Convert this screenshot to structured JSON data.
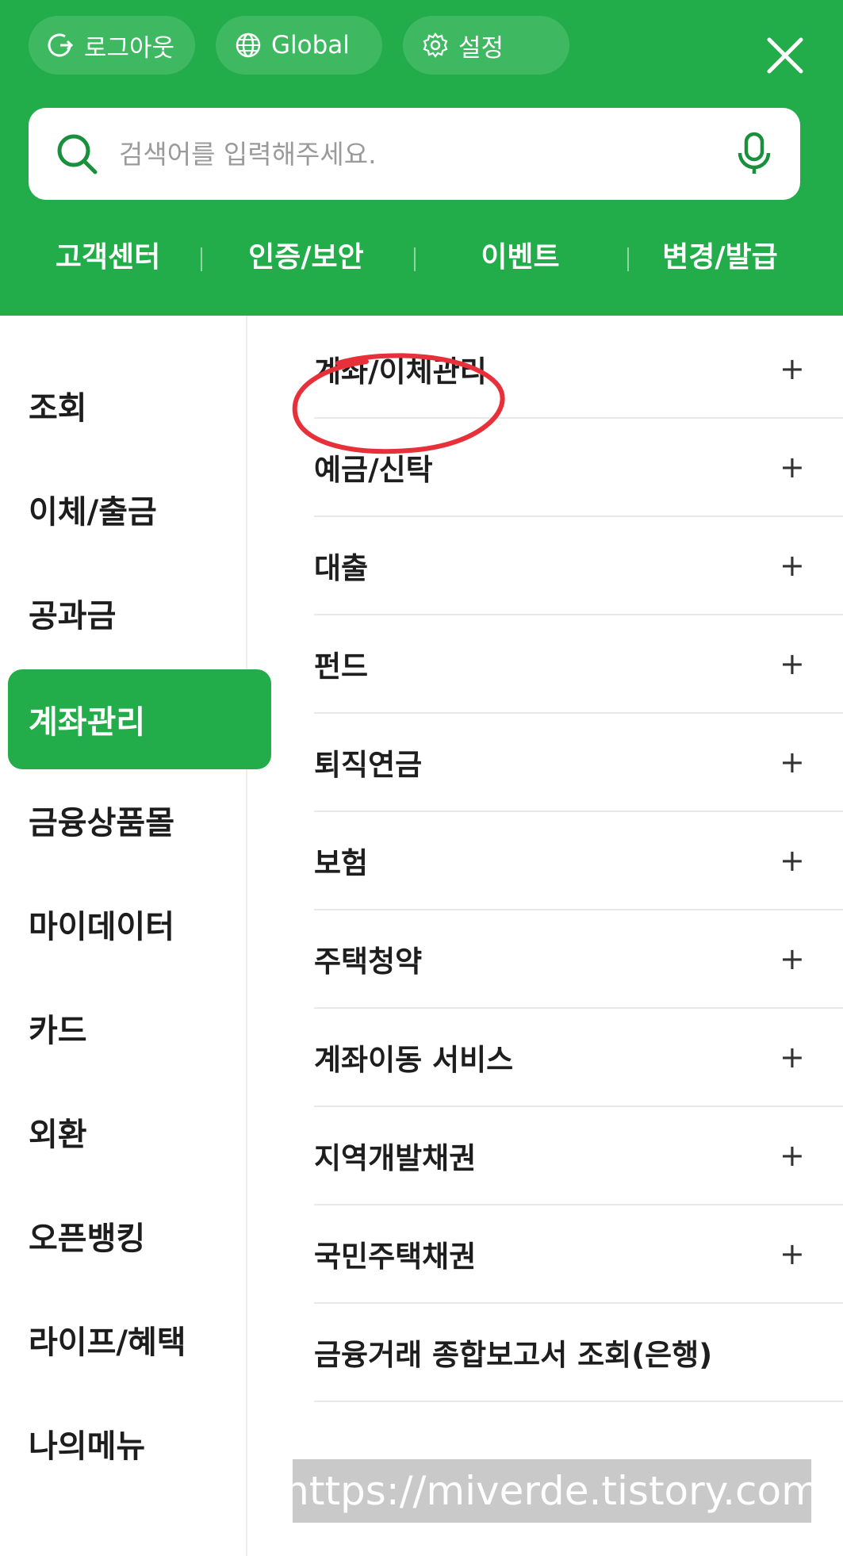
{
  "header": {
    "chips": [
      {
        "label": "로그아웃",
        "icon": "logout-icon"
      },
      {
        "label": "Global",
        "icon": "globe-icon"
      },
      {
        "label": "설정",
        "icon": "gear-icon"
      }
    ],
    "close_icon": "close-icon",
    "search": {
      "placeholder": "검색어를 입력해주세요.",
      "value": "",
      "icon": "search-icon",
      "mic_icon": "microphone-icon"
    },
    "quick_links": [
      "고객센터",
      "인증/보안",
      "이벤트",
      "변경/발급"
    ]
  },
  "sidebar": {
    "items": [
      "조회",
      "이체/출금",
      "공과금",
      "계좌관리",
      "금융상품몰",
      "마이데이터",
      "카드",
      "외환",
      "오픈뱅킹",
      "라이프/혜택",
      "나의메뉴"
    ],
    "active": "계좌관리"
  },
  "content": {
    "rows": [
      {
        "label": "계좌/이체관리",
        "expand": "+"
      },
      {
        "label": "예금/신탁",
        "expand": "+"
      },
      {
        "label": "대출",
        "expand": "+"
      },
      {
        "label": "펀드",
        "expand": "+"
      },
      {
        "label": "퇴직연금",
        "expand": "+"
      },
      {
        "label": "보험",
        "expand": "+"
      },
      {
        "label": "주택청약",
        "expand": "+"
      },
      {
        "label": "계좌이동 서비스",
        "expand": "+"
      },
      {
        "label": "지역개발채권",
        "expand": "+"
      },
      {
        "label": "국민주택채권",
        "expand": "+"
      },
      {
        "label": "금융거래 종합보고서 조회(은행)",
        "expand": ""
      }
    ]
  },
  "watermark": "https://miverde.tistory.com",
  "colors": {
    "brand_green": "#22ac4a",
    "annotation_red": "#e8303a"
  }
}
